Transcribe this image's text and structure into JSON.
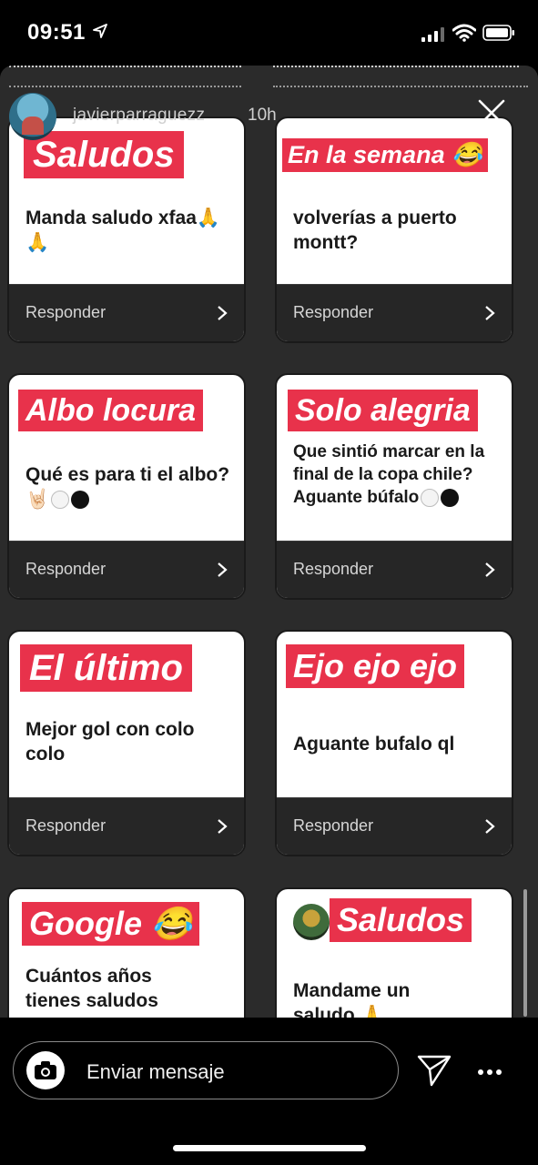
{
  "status_bar": {
    "time": "09:51"
  },
  "story": {
    "username": "javierparraguezz",
    "time_ago": "10h"
  },
  "cards": [
    {
      "banner": "Saludos",
      "question": "Manda saludo xfaa🙏🙏",
      "respond": "Responder"
    },
    {
      "banner": "En la semana 😂",
      "question": "volverías a puerto montt?",
      "respond": "Responder"
    },
    {
      "banner": "Albo locura",
      "question": "Qué es para ti el albo?🤘🏻",
      "respond": "Responder"
    },
    {
      "banner": "Solo alegria",
      "question": "Que sintió marcar en la final de la copa chile? Aguante búfalo",
      "respond": "Responder"
    },
    {
      "banner": "El último",
      "question": "Mejor gol con colo colo",
      "respond": "Responder"
    },
    {
      "banner": "Ejo ejo ejo",
      "question": "Aguante bufalo ql",
      "respond": "Responder"
    },
    {
      "banner": "Google 😂",
      "question": "Cuántos años tienes saludos",
      "respond": ""
    },
    {
      "banner": "Saludos",
      "question": "Mandame un saludo 🙏",
      "respond": ""
    }
  ],
  "composer": {
    "placeholder": "Enviar mensaje"
  },
  "icons": {
    "camera": "camera-icon",
    "send": "paper-plane-icon",
    "more": "ellipsis-icon",
    "close": "close-icon"
  }
}
